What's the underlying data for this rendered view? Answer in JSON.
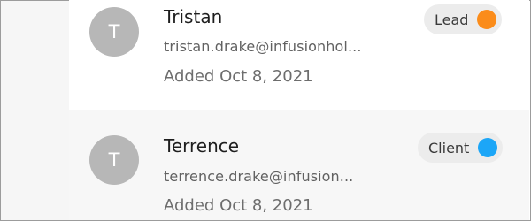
{
  "contacts": [
    {
      "avatar_initial": "T",
      "name": "Tristan",
      "email": "tristan.drake@infusionhol...",
      "added": "Added Oct 8, 2021",
      "status": "Lead",
      "status_color": "#fb8c1a"
    },
    {
      "avatar_initial": "T",
      "name": "Terrence",
      "email": "terrence.drake@infusion...",
      "added": "Added Oct 8, 2021",
      "status": "Client",
      "status_color": "#1ca6f7"
    }
  ]
}
